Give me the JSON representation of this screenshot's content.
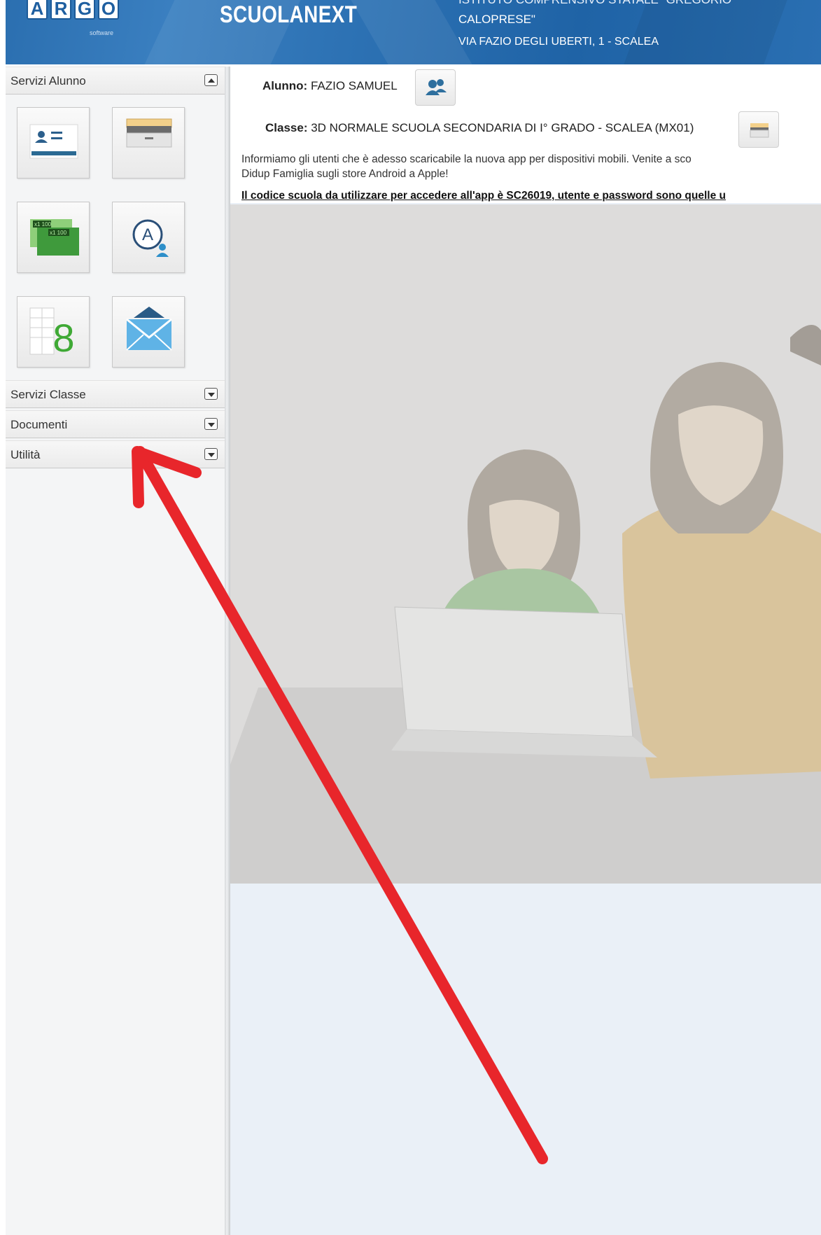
{
  "header": {
    "logo_letters": [
      "A",
      "R",
      "G",
      "O"
    ],
    "logo_sub": "software",
    "brand": "SCUOLANEXT",
    "school_line1": "ISTITUTO COMPRENSIVO STATALE \"GREGORIO",
    "school_line2": "CALOPRESE\"",
    "school_address": "VIA FAZIO DEGLI UBERTI, 1 - SCALEA",
    "color": "#2b6fb0"
  },
  "sidebar": {
    "panels": [
      {
        "title": "Servizi Alunno",
        "state": "expanded"
      },
      {
        "title": "Servizi Classe",
        "state": "collapsed"
      },
      {
        "title": "Documenti",
        "state": "collapsed"
      },
      {
        "title": "Utilità",
        "state": "collapsed"
      }
    ],
    "tiles": [
      {
        "icon": "student-card-icon"
      },
      {
        "icon": "archive-drawer-icon"
      },
      {
        "icon": "grades-report-icon",
        "text_a": "x1 100",
        "text_b": "x1 100"
      },
      {
        "icon": "user-assign-icon",
        "text": "A"
      },
      {
        "icon": "grade-notebook-icon",
        "text": "8"
      },
      {
        "icon": "mail-envelope-icon"
      }
    ]
  },
  "main": {
    "alunno_label": "Alunno:",
    "alunno_value": "FAZIO SAMUEL",
    "classe_label": "Classe:",
    "classe_value": "3D NORMALE SCUOLA SECONDARIA DI I° GRADO - SCALEA (MX01)",
    "info_line1": "Informiamo gli utenti che è adesso scaricabile la nuova app per dispositivi mobili. Venite a sco",
    "info_line2": "Didup Famiglia sugli store Android a Apple!",
    "info_bold": "Il codice scuola da utilizzare per accedere all'app è SC26019, utente e password sono quelle u"
  },
  "annotation": {
    "arrow_color": "#e8262b"
  }
}
